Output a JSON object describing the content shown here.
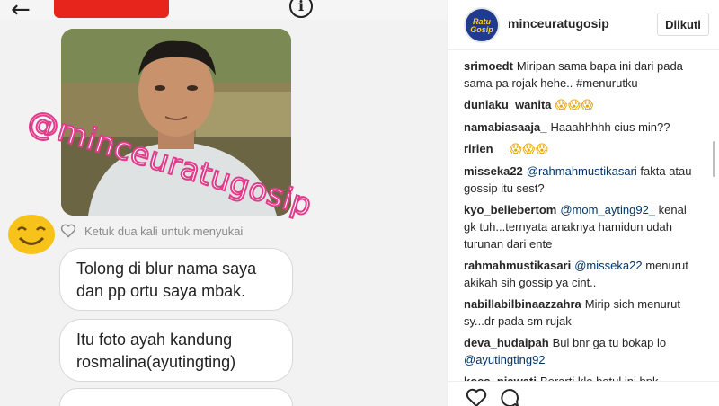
{
  "post_image": {
    "watermark": "@minceuratugosip",
    "like_hint": "Ketuk dua kali untuk menyukai",
    "messages": [
      "Tolong di blur nama saya dan pp ortu saya mbak.",
      "Itu foto ayah kandung rosmalina(ayutingting)",
      ""
    ]
  },
  "header": {
    "avatar_text_1": "Ratu",
    "avatar_text_2": "Gosip",
    "username": "minceuratugosip",
    "follow_label": "Diikuti"
  },
  "comments": [
    {
      "user": "srimoedt",
      "text": "Miripan sama bapa ini dari pada sama pa rojak hehe.. #menurutku"
    },
    {
      "user": "duniaku_wanita",
      "text": "😱😱😱"
    },
    {
      "user": "namabiasaaja_",
      "text": "Haaahhhhh cius min??"
    },
    {
      "user": "ririen__",
      "text": "😱😱😱"
    },
    {
      "user": "misseka22",
      "mention": "@rahmahmustikasari",
      "text": " fakta atau gossip itu sest?"
    },
    {
      "user": "kyo_beliebertom",
      "mention": "@mom_ayting92_",
      "text": " kenal gk tuh...ternyata anaknya hamidun udah turunan dari ente"
    },
    {
      "user": "rahmahmustikasari",
      "mention": "@misseka22",
      "text": " menurut akikah sih gossip ya cint.."
    },
    {
      "user": "nabillabilbinaazzahra",
      "text": "Mirip sich menurut sy...dr pada sm rujak"
    },
    {
      "user": "deva_hudaipah",
      "text": "Bul bnr ga tu bokap lo ",
      "mention_after": "@ayutingting92"
    },
    {
      "user": "koes_niawati",
      "text": "Berarti klo betul ini bpk nya..waktu nikah ma enji ga syah dong..kan"
    }
  ]
}
